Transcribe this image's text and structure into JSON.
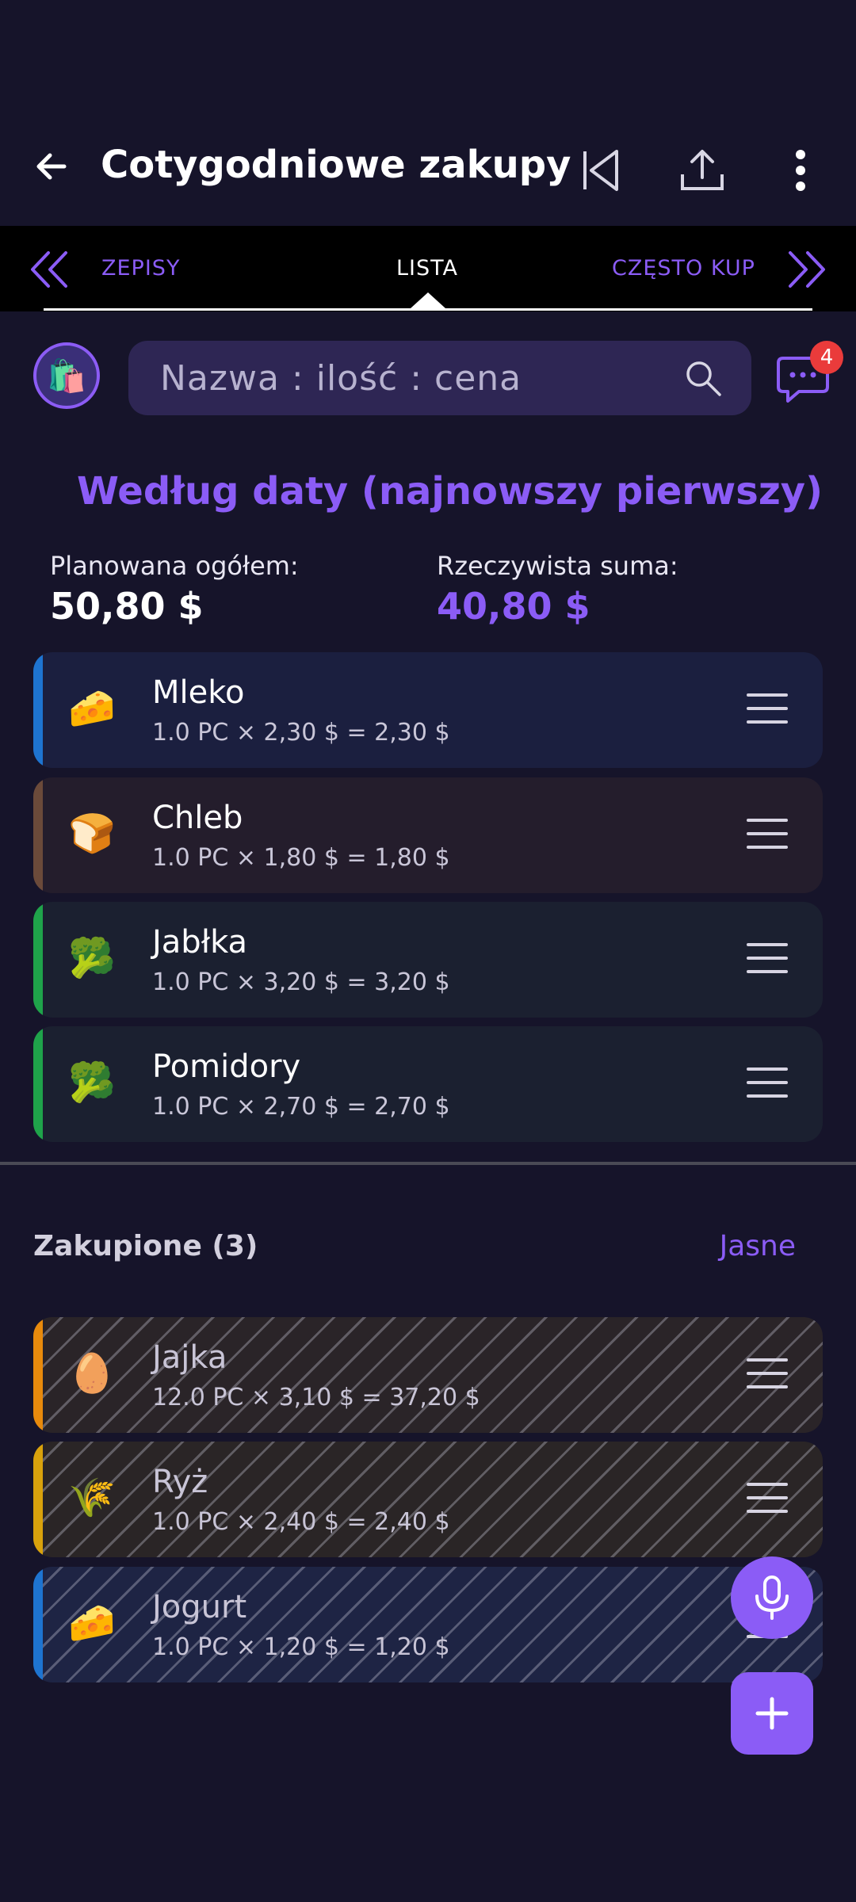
{
  "appbar": {
    "title": "Cotygodniowe zakupy",
    "back_icon": "arrow-left-icon",
    "actions": [
      "skip-previous-icon",
      "share-icon",
      "more-vertical-icon"
    ]
  },
  "tabs": {
    "items": [
      {
        "label": "ZEPISY",
        "active": false
      },
      {
        "label": "LISTA",
        "active": true
      },
      {
        "label": "CZĘSTO KUP",
        "active": false
      }
    ],
    "prev_icon": "double-chevron-left-icon",
    "next_icon": "double-chevron-right-icon"
  },
  "search": {
    "placeholder": "Nazwa : ilość : cena",
    "chat_badge": "4"
  },
  "sort": {
    "label": "Według daty (najnowszy pierwszy)"
  },
  "totals": {
    "planned_label": "Planowana ogółem:",
    "planned_value": "50,80 $",
    "actual_label": "Rzeczywista suma:",
    "actual_value": "40,80 $"
  },
  "items": [
    {
      "name": "Mleko",
      "detail": "1.0 PC × 2,30 $ = 2,30 $",
      "icon": "🧀",
      "color": "#1e74d0"
    },
    {
      "name": "Chleb",
      "detail": "1.0 PC × 1,80 $ = 1,80 $",
      "icon": "🍞",
      "color": "#6b4a3a"
    },
    {
      "name": "Jabłka",
      "detail": "1.0 PC × 3,20 $ = 3,20 $",
      "icon": "🥦",
      "color": "#1fa34a"
    },
    {
      "name": "Pomidory",
      "detail": "1.0 PC × 2,70 $ = 2,70 $",
      "icon": "🥦",
      "color": "#1fa34a"
    }
  ],
  "purchased": {
    "title": "Zakupione (3)",
    "clear_label": "Jasne",
    "items": [
      {
        "name": "Jajka",
        "detail": "12.0 PC × 3,10 $ = 37,20 $",
        "icon": "🥚",
        "color": "#e88a0c"
      },
      {
        "name": "Ryż",
        "detail": "1.0 PC × 2,40 $ = 2,40 $",
        "icon": "🌾",
        "color": "#d9a20c"
      },
      {
        "name": "Jogurt",
        "detail": "1.0 PC × 1,20 $ = 1,20 $",
        "icon": "🧀",
        "color": "#1e74d0"
      }
    ]
  },
  "fab": {
    "mic_icon": "microphone-icon",
    "add_icon": "plus-icon"
  },
  "colors": {
    "accent": "#8b5cf6",
    "background": "#16142a"
  }
}
